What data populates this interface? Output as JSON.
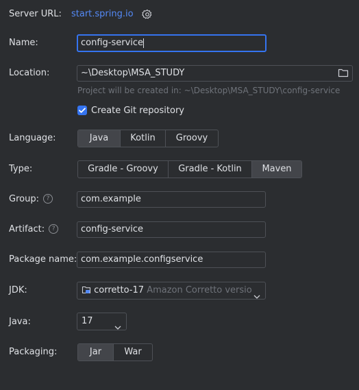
{
  "server": {
    "label": "Server URL:",
    "url": "start.spring.io",
    "settings_icon": "gear-icon"
  },
  "name": {
    "label": "Name:",
    "value": "config-service"
  },
  "location": {
    "label": "Location:",
    "value": "~\\Desktop\\MSA_STUDY",
    "hint": "Project will be created in: ~\\Desktop\\MSA_STUDY\\config-service",
    "browse_icon": "folder-icon"
  },
  "git": {
    "label": "Create Git repository",
    "checked": true
  },
  "language": {
    "label": "Language:",
    "options": [
      "Java",
      "Kotlin",
      "Groovy"
    ],
    "selected": "Java"
  },
  "type": {
    "label": "Type:",
    "options": [
      "Gradle - Groovy",
      "Gradle - Kotlin",
      "Maven"
    ],
    "selected": "Maven"
  },
  "group": {
    "label": "Group:",
    "value": "com.example"
  },
  "artifact": {
    "label": "Artifact:",
    "value": "config-service"
  },
  "package": {
    "label": "Package name:",
    "value": "com.example.configservice"
  },
  "jdk": {
    "label": "JDK:",
    "name": "corretto-17",
    "detail": "Amazon Corretto versio"
  },
  "java": {
    "label": "Java:",
    "value": "17"
  },
  "packaging": {
    "label": "Packaging:",
    "options": [
      "Jar",
      "War"
    ],
    "selected": "Jar"
  }
}
